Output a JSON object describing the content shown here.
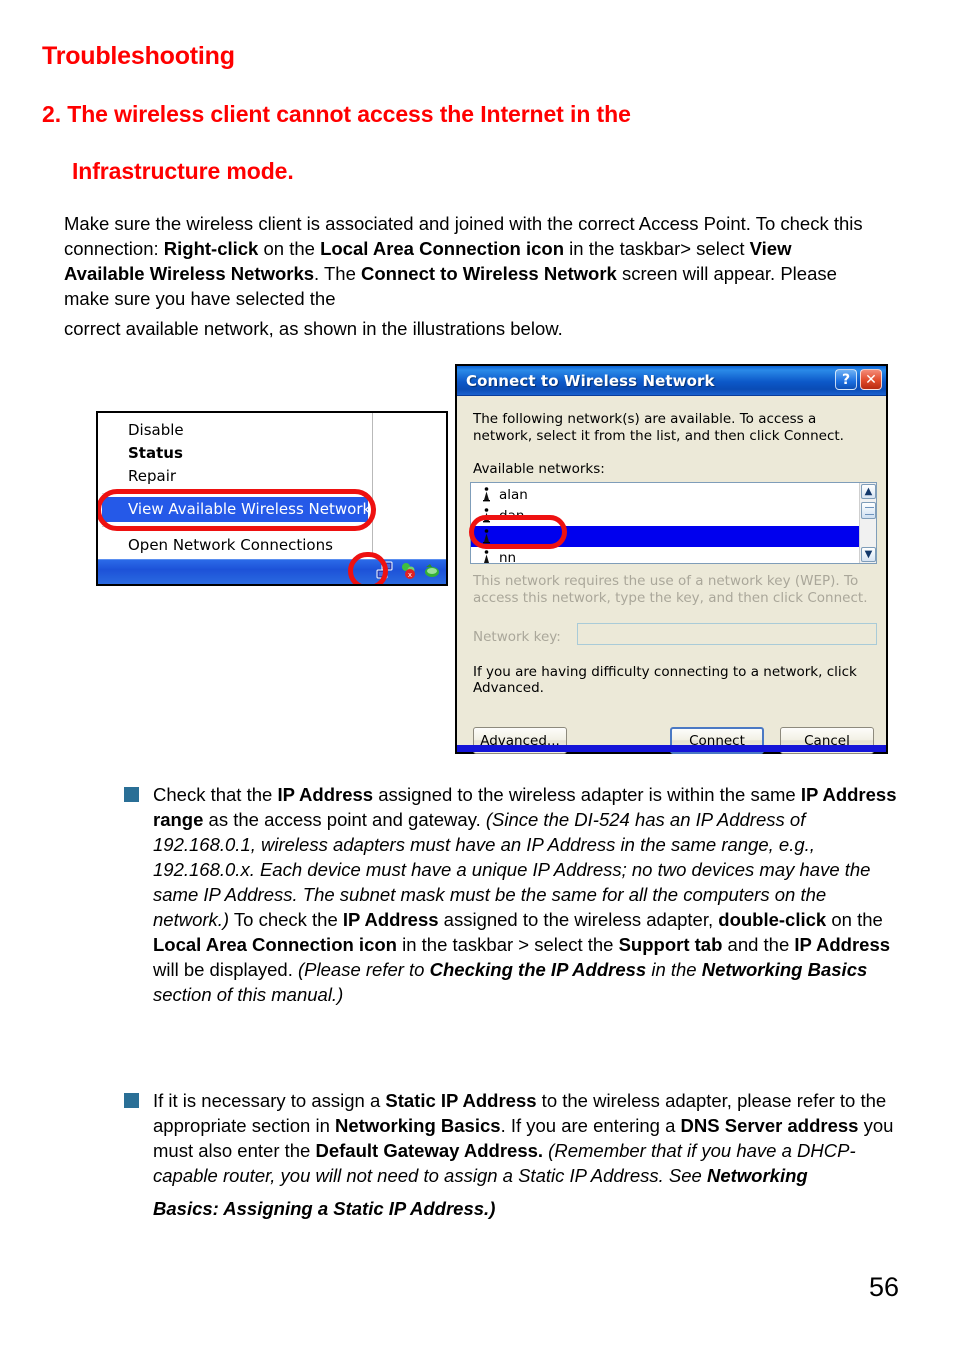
{
  "headings": {
    "section": "Troubleshooting",
    "item_line1": "2. The wireless client cannot access the Internet in the",
    "item_line2": "Infrastructure mode."
  },
  "intro": {
    "p1_a": "Make sure the wireless client is associated and joined with the correct Access Point. To check this connection:  ",
    "b1": "Right-click",
    "p1_b": " on the ",
    "b2": "Local Area Connection icon",
    "p1_c": " in the taskbar> select ",
    "b3": "View Available Wireless Networks",
    "p1_d": ". The ",
    "b4": "Connect to Wireless Network",
    "p1_e": " screen will appear.  Please make sure you have selected the ",
    "p1_f": "correct available network, as shown in the illustrations below."
  },
  "context_menu": {
    "items": [
      {
        "label": "Disable",
        "bold": false
      },
      {
        "label": "Status",
        "bold": true
      },
      {
        "label": "Repair",
        "bold": false
      }
    ],
    "highlighted_item": "View Available Wireless Networks",
    "last_item": "Open Network Connections",
    "tray_icons": [
      "network-connection-icon",
      "antivirus-icon",
      "utility-icon"
    ],
    "highlight_color": "#2559e8",
    "annotation_color": "#ee1111"
  },
  "dialog": {
    "title": "Connect to Wireless Network",
    "help_button": "?",
    "close_button": "✕",
    "description": "The following network(s) are available. To access a network, select it from the list, and then click Connect.",
    "available_label": "Available networks:",
    "networks": [
      {
        "name": "alan",
        "selected": false
      },
      {
        "name": "dan",
        "selected": false
      },
      {
        "name": "",
        "selected": true
      },
      {
        "name": "nn",
        "selected": false
      }
    ],
    "wep_note": "This network requires the use of a network key (WEP). To access this network, type the key, and then click Connect.",
    "network_key_label": "Network key:",
    "network_key_value": "",
    "advanced_note": "If you are having difficulty connecting to a network, click Advanced.",
    "buttons": {
      "advanced": "Advanced...",
      "connect": "Connect",
      "cancel": "Cancel"
    },
    "scrollbar": {
      "up": "▲",
      "down": "▼"
    },
    "titlebar_color": "#0c58c8",
    "selection_color": "#0000ee"
  },
  "bullets": {
    "one": {
      "t1": "Check that the ",
      "b1": "IP Address",
      "t2": " assigned to the wireless adapter is within the same ",
      "b2": "IP Address range",
      "t3": " as the access point and gateway. ",
      "i1": "(Since the  DI-524 has an IP Address of 192.168.0.1, wireless adapters must have an IP Address in the same range, e.g., 192.168.0.x.  Each device must have a unique IP Address; no two devices may have the same IP Address. The subnet mask must be the same for all the computers on the network.)",
      "t4": " To check the ",
      "b3": "IP Address",
      "t5": " assigned to the wireless adapter, ",
      "b4": "double-click",
      "t6": " on the ",
      "b5": "Local Area Connection icon",
      "t7": " in the taskbar > select the ",
      "b6": "Support tab",
      "t8": " and the ",
      "b7": "IP Address",
      "t9": " will be displayed. ",
      "i2": "(Please refer to ",
      "ib1": "Checking the IP Address",
      "i3": " in the ",
      "ib2": "Networking Basics",
      "i4": " section of this manual.)"
    },
    "two": {
      "t1": "If it is necessary to assign a ",
      "b1": "Static IP Address",
      "t2": " to the wireless adapter, please refer to the appropriate section in ",
      "b2": "Networking Basics",
      "t3": ". If you are entering a ",
      "b3": "DNS Server address",
      "t4": " you must also enter the ",
      "b4": "Default Gateway Address.",
      "i1": " (Remember that if you have a DHCP-capable router, you will not need to assign a Static IP Address.  See ",
      "ib1": "Networking",
      "last": "Basics: Assigning a Static IP Address.)"
    }
  },
  "page_number": "56"
}
